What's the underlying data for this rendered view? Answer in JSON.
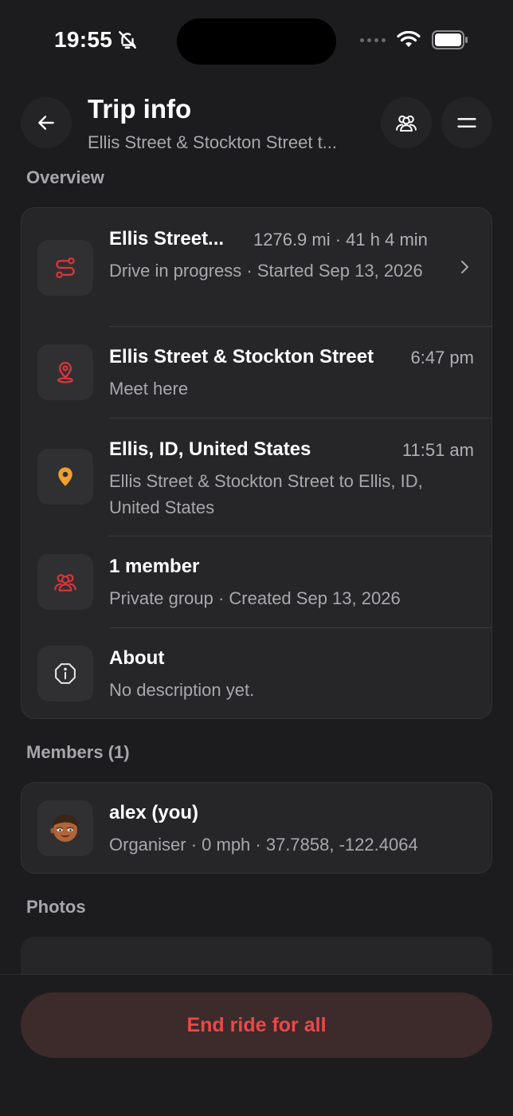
{
  "status_bar": {
    "time": "19:55"
  },
  "header": {
    "title": "Trip info",
    "subtitle": "Ellis Street & Stockton Street t..."
  },
  "overview": {
    "label": "Overview",
    "rows": [
      {
        "title": "Ellis Street...",
        "meta": "1276.9 mi · 41 h 4 min",
        "sub": "Drive in progress · Started Sep 13, 2026",
        "icon": "route-icon"
      },
      {
        "title": "Ellis Street & Stockton Street",
        "meta": "6:47 pm",
        "sub": "Meet here",
        "icon": "meeting-point-icon"
      },
      {
        "title": "Ellis, ID, United States",
        "meta": "11:51 am",
        "sub": "Ellis Street & Stockton Street to Ellis, ID, United States",
        "icon": "destination-pin-icon"
      },
      {
        "title": "1 member",
        "meta": "",
        "sub": "Private group · Created Sep 13, 2026",
        "icon": "group-icon"
      },
      {
        "title": "About",
        "meta": "",
        "sub": "No description yet.",
        "icon": "info-icon"
      }
    ]
  },
  "members": {
    "label": "Members (1)",
    "items": [
      {
        "name": "alex (you)",
        "detail": "Organiser · 0 mph · 37.7858, -122.4064"
      }
    ]
  },
  "photos": {
    "label": "Photos"
  },
  "actions": {
    "end_ride_label": "End ride for all"
  },
  "colors": {
    "accent_red": "#e0343a",
    "accent_orange": "#f0a030",
    "danger_text": "#ec4848",
    "background": "#1c1c1e"
  }
}
